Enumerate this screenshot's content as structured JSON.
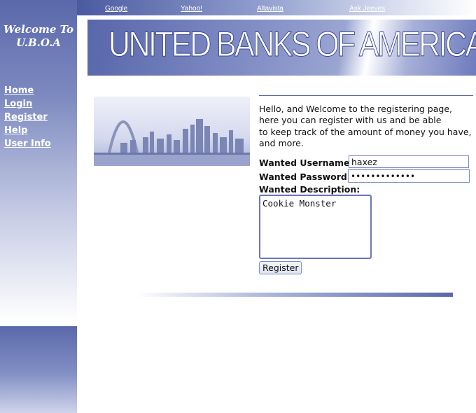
{
  "topbar": {
    "links": [
      "Google",
      "Yahoo!",
      "Altavista",
      "Ask Jeeves"
    ]
  },
  "sidebar": {
    "welcome_line1": "Welcome To",
    "welcome_line2": "U.B.O.A",
    "nav": [
      "Home",
      "Login",
      "Register",
      "Help",
      "User Info"
    ]
  },
  "banner": {
    "title": "UNITED BANKS OF AMERICA"
  },
  "content": {
    "intro_lines": [
      "Hello, and Welcome to the registering page,",
      "here you can register with us and be able",
      "to keep track of the amount of money you have,",
      "and more."
    ],
    "username_label": "Wanted Username:",
    "username_value": "haxez",
    "password_label": "Wanted Password:",
    "password_value": "•••••••••••••",
    "description_label": "Wanted Description:",
    "description_value": "Cookie Monster",
    "register_label": "Register"
  },
  "colors": {
    "accent": "#5a68aa",
    "accent_light": "#c3c9e3"
  }
}
